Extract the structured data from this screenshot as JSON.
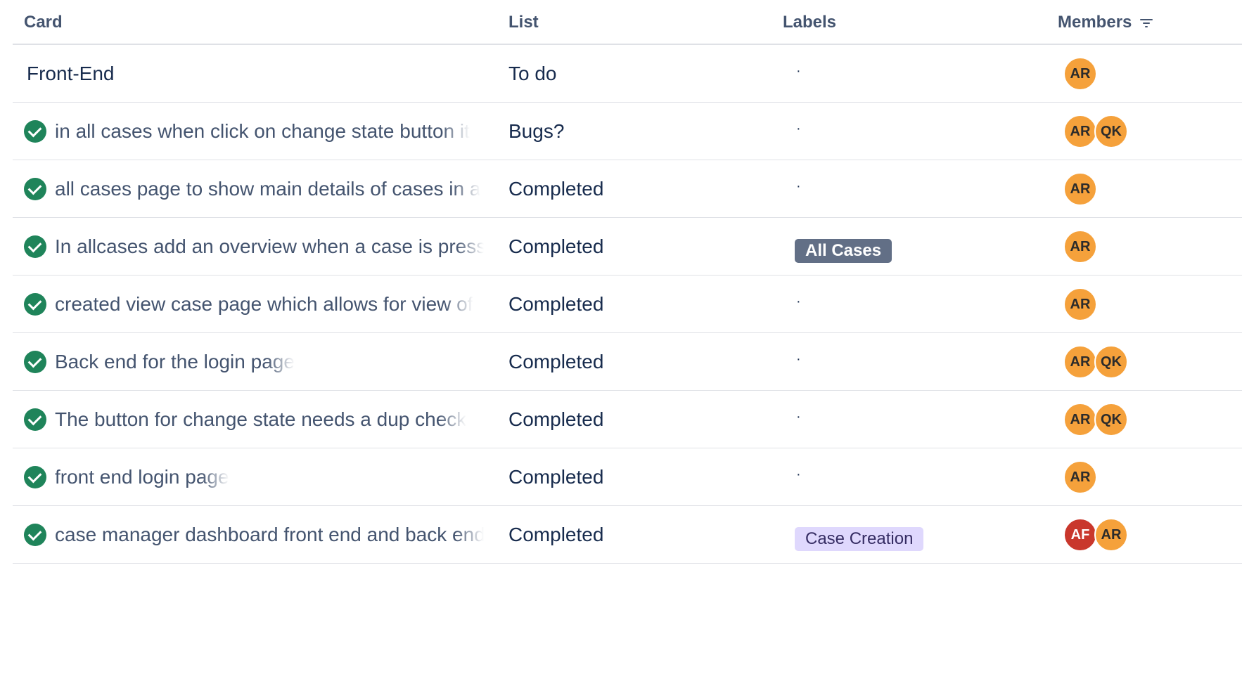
{
  "table": {
    "headers": {
      "card": "Card",
      "list": "List",
      "labels": "Labels",
      "members": "Members"
    },
    "rows": [
      {
        "card": "Front-End",
        "completed": false,
        "list": "To do",
        "label_text": "·",
        "label_type": "empty",
        "members": [
          {
            "initials": "AR",
            "color": "#f5a13b"
          }
        ]
      },
      {
        "card": "in all cases when click on change state button it",
        "completed": true,
        "list": "Bugs?",
        "label_text": "·",
        "label_type": "empty",
        "members": [
          {
            "initials": "AR",
            "color": "#f5a13b"
          },
          {
            "initials": "QK",
            "color": "#f5a13b"
          }
        ]
      },
      {
        "card": "all cases page to show main details of cases in a",
        "completed": true,
        "list": "Completed",
        "label_text": "·",
        "label_type": "empty",
        "members": [
          {
            "initials": "AR",
            "color": "#f5a13b"
          }
        ]
      },
      {
        "card": "In allcases add an overview when a case is pressed",
        "completed": true,
        "list": "Completed",
        "label_text": "All Cases",
        "label_type": "gray",
        "members": [
          {
            "initials": "AR",
            "color": "#f5a13b"
          }
        ]
      },
      {
        "card": "created view case page which allows for view of",
        "completed": true,
        "list": "Completed",
        "label_text": "·",
        "label_type": "empty",
        "members": [
          {
            "initials": "AR",
            "color": "#f5a13b"
          }
        ]
      },
      {
        "card": "Back end for the login page",
        "completed": true,
        "list": "Completed",
        "label_text": "·",
        "label_type": "empty",
        "members": [
          {
            "initials": "AR",
            "color": "#f5a13b"
          },
          {
            "initials": "QK",
            "color": "#f5a13b"
          }
        ]
      },
      {
        "card": "The button for change state needs a dup check",
        "completed": true,
        "list": "Completed",
        "label_text": "·",
        "label_type": "empty",
        "members": [
          {
            "initials": "AR",
            "color": "#f5a13b"
          },
          {
            "initials": "QK",
            "color": "#f5a13b"
          }
        ]
      },
      {
        "card": "front end login page",
        "completed": true,
        "list": "Completed",
        "label_text": "·",
        "label_type": "empty",
        "members": [
          {
            "initials": "AR",
            "color": "#f5a13b"
          }
        ]
      },
      {
        "card": "case manager dashboard front end and back end",
        "completed": true,
        "list": "Completed",
        "label_text": "Case Creation",
        "label_type": "purple",
        "members": [
          {
            "initials": "AF",
            "color": "#c9372c"
          },
          {
            "initials": "AR",
            "color": "#f5a13b"
          }
        ]
      }
    ]
  },
  "icons": {
    "complete": "check-circle-icon",
    "members_filter": "filter-icon"
  },
  "colors": {
    "complete_green": "#1f845a",
    "avatar_orange": "#f5a13b",
    "avatar_red": "#c9372c",
    "badge_gray": "#626f86",
    "badge_purple": "#dfd8fd"
  }
}
